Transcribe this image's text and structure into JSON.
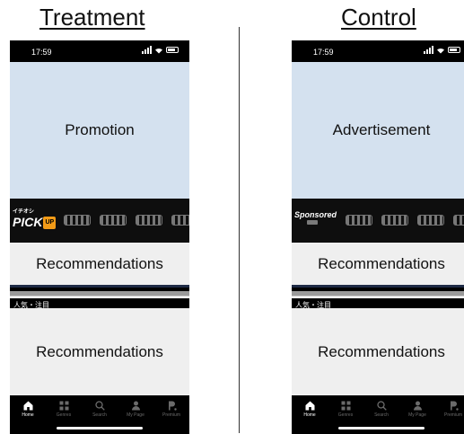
{
  "headings": {
    "treatment": "Treatment",
    "control": "Control"
  },
  "treatment": {
    "status_time": "17:59",
    "hero": "Promotion",
    "channels": {
      "lead_small": "イチオシ",
      "lead_main": "PICK",
      "lead_badge": "UP"
    },
    "recommendations_top": "Recommendations",
    "section_label": "人気・注目",
    "recommendations_bottom": "Recommendations"
  },
  "control": {
    "status_time": "17:59",
    "hero": "Advertisement",
    "channels": {
      "lead_main": "Sponsored",
      "lead_badge": "AD"
    },
    "recommendations_top": "Recommendations",
    "section_label": "人気・注目",
    "recommendations_bottom": "Recommendations"
  },
  "tabbar": {
    "home": "Home",
    "genres": "Genres",
    "search": "Search",
    "my_page": "My Page",
    "premium": "Premium"
  },
  "colors": {
    "hero_bg": "#d4e1ef",
    "reco_bg": "#efefef",
    "pick_badge": "#f29b17"
  }
}
